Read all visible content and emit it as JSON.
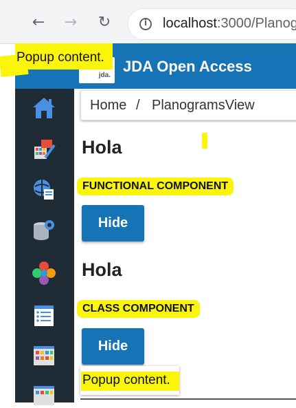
{
  "browser": {
    "back_icon": "back-arrow-icon",
    "forward_icon": "forward-arrow-icon",
    "reload_icon": "reload-icon",
    "info_icon": "info-icon",
    "url_host": "localhost",
    "url_rest": ":3000/Planog"
  },
  "header": {
    "logo_text": "jda.",
    "title": "JDA Open Access"
  },
  "sidebar": {
    "items": [
      {
        "icon": "home-icon"
      },
      {
        "icon": "planogram-edit-icon"
      },
      {
        "icon": "globe-document-icon"
      },
      {
        "icon": "database-settings-icon"
      },
      {
        "icon": "flower-puzzle-icon"
      },
      {
        "icon": "list-icon"
      },
      {
        "icon": "planogram-grid-icon"
      },
      {
        "icon": "planogram-grid-icon"
      }
    ]
  },
  "breadcrumb": {
    "home": "Home",
    "separator": "/",
    "current": "PlanogramsView"
  },
  "sections": [
    {
      "heading": "Hola",
      "label": "FUNCTIONAL COMPONENT",
      "button": "Hide"
    },
    {
      "heading": "Hola",
      "label": "CLASS COMPONENT",
      "button": "Hide"
    }
  ],
  "popups": {
    "top": "Popup content.",
    "bottom": "Popup content."
  },
  "colors": {
    "brand_blue": "#1573b6",
    "sidebar_dark": "#1f2b35",
    "highlight_yellow": "#fbf50a"
  }
}
